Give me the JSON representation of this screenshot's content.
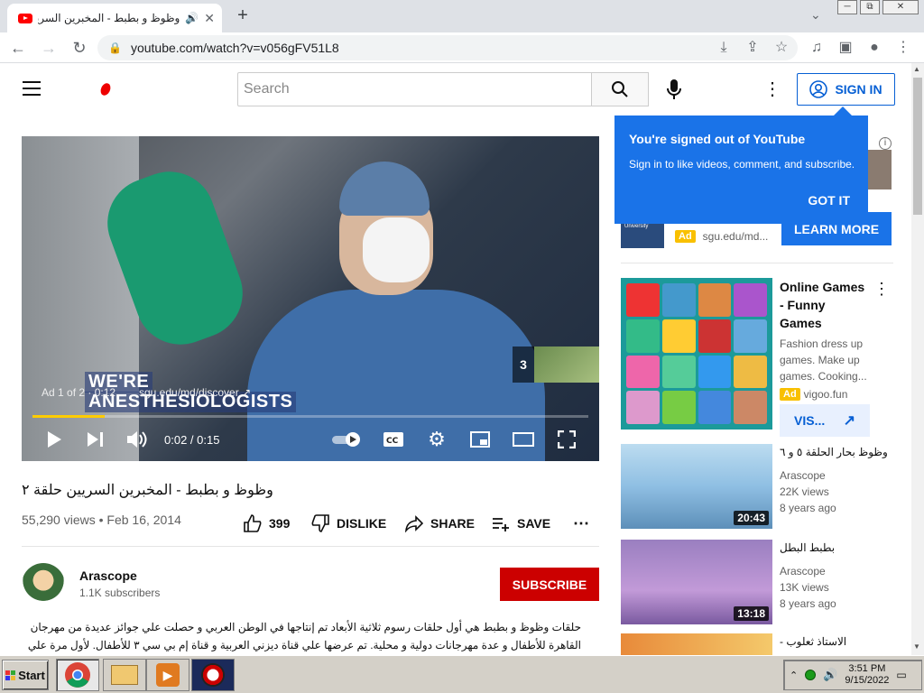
{
  "browser": {
    "tab_title": "وظوظ و بطبط - المخبرين السريين",
    "url": "youtube.com/watch?v=v056gFV51L8",
    "new_tab": "+",
    "win_min": "─",
    "win_max": "⧉",
    "win_close": "✕",
    "tab_close": "✕"
  },
  "masthead": {
    "search_placeholder": "Search",
    "sign_in": "SIGN IN"
  },
  "player": {
    "headline_line1": "WE'RE",
    "headline_line2": "ANESTHESIOLOGISTS",
    "ad_info": "Ad 1 of 2 · 0:12",
    "ad_url": "sgu.edu/md/discover",
    "next_ad_count": "3",
    "time": "0:02 / 0:15",
    "progress_fraction": 0.13
  },
  "tooltip": {
    "title": "You're signed out of YouTube",
    "body": "Sign in to like videos, comment, and subscribe.",
    "got_it": "GOT IT"
  },
  "video": {
    "title": "وظوظ و بطبط - المخبرين السريين حلقة ٢",
    "views": "55,290 views",
    "date": "Feb 16, 2014",
    "likes": "399",
    "dislike": "DISLIKE",
    "share": "SHARE",
    "save": "SAVE"
  },
  "channel": {
    "name": "Arascope",
    "subscribers": "1.1K subscribers",
    "subscribe": "SUBSCRIBE"
  },
  "description": "حلقات وظوظ و بطبط هي أول حلقات رسوم ثلاثية الأبعاد تم إنتاجها في الوطن العربي و حصلت علي جوائز عديدة من مهرجان القاهرة للأطفال و عدة مهرجانات دولية و محلية. تم عرضها علي قناة ديزني العربية و قناة إم بي سي ٣ للأطفال. لأول مرة علي",
  "sidebar": {
    "top_ad": {
      "sgu_logo_text": "St. George's University",
      "ad_badge": "Ad",
      "url": "sgu.edu/md...",
      "cta": "LEARN MORE"
    },
    "games_ad": {
      "title": "Online Games - Funny Games",
      "desc": "Fashion dress up games. Make up games. Cooking...",
      "ad_badge": "Ad",
      "url": "vigoo.fun",
      "cta": "VIS..."
    },
    "videos": [
      {
        "title": "وظوظ بحار الحلقة ٥ و ٦",
        "channel": "Arascope",
        "views": "22K views",
        "age": "8 years ago",
        "duration": "20:43"
      },
      {
        "title": "بطبط البطل",
        "channel": "Arascope",
        "views": "13K views",
        "age": "8 years ago",
        "duration": "13:18"
      },
      {
        "title": "الاستاذ ثعلوب -",
        "channel": "",
        "views": "",
        "age": "",
        "duration": ""
      }
    ]
  },
  "taskbar": {
    "start": "Start",
    "time": "3:51 PM",
    "date": "9/15/2022"
  },
  "colors": {
    "youtube_red": "#ff0000",
    "brand_blue": "#065fd4",
    "tooltip_blue": "#1a73e8",
    "subscribe_red": "#cc0000",
    "ad_yellow": "#f9c000"
  }
}
